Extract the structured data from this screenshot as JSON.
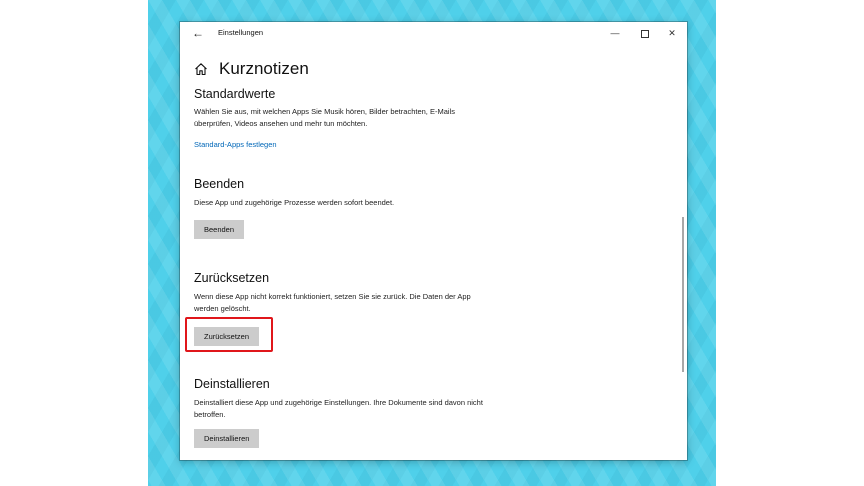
{
  "window": {
    "title": "Einstellungen",
    "back_glyph": "←",
    "minimize_glyph": "—",
    "close_glyph": "✕"
  },
  "page": {
    "title": "Kurznotizen"
  },
  "sections": {
    "standardwerte": {
      "title": "Standardwerte",
      "description": "Wählen Sie aus, mit welchen Apps Sie Musik hören, Bilder betrachten, E-Mails überprüfen, Videos ansehen und mehr tun möchten.",
      "link": "Standard-Apps festlegen"
    },
    "beenden": {
      "title": "Beenden",
      "description": "Diese App und zugehörige Prozesse werden sofort beendet.",
      "button": "Beenden"
    },
    "zuruecksetzen": {
      "title": "Zurücksetzen",
      "description": "Wenn diese App nicht korrekt funktioniert, setzen Sie sie zurück. Die Daten der App werden gelöscht.",
      "button": "Zurücksetzen"
    },
    "deinstallieren": {
      "title": "Deinstallieren",
      "description": "Deinstalliert diese App und zugehörige Einstellungen. Ihre Dokumente sind davon nicht betroffen.",
      "button": "Deinstallieren"
    }
  },
  "colors": {
    "link": "#0067b8",
    "button_bg": "#cccccc",
    "highlight": "#e0161b",
    "backdrop": "#4fd0ea"
  },
  "icons": {
    "heading": "home-icon",
    "back": "back-arrow-icon"
  }
}
